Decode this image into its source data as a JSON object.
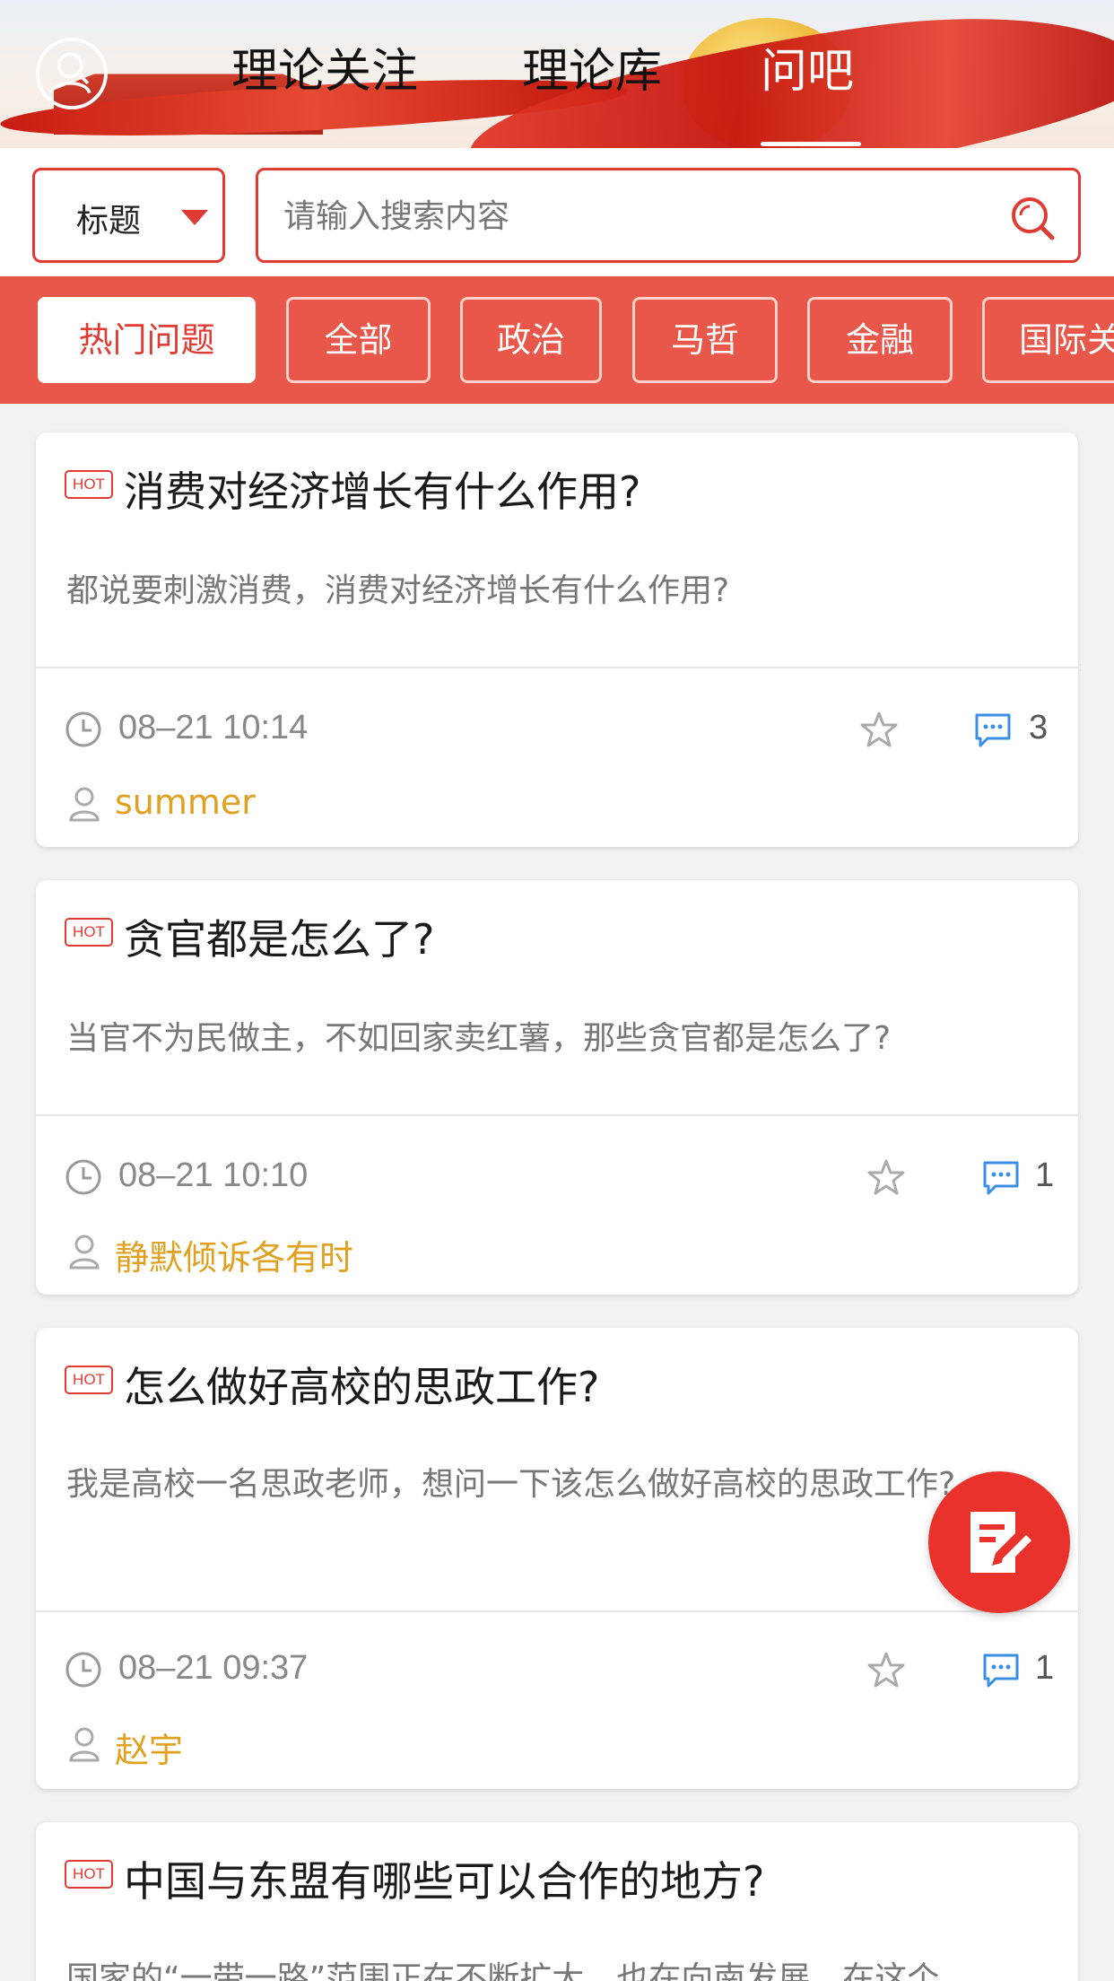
{
  "header": {
    "tabs": [
      {
        "label": "理论关注",
        "active": false
      },
      {
        "label": "理论库",
        "active": false
      },
      {
        "label": "问吧",
        "active": true
      }
    ]
  },
  "search": {
    "field_selected": "标题",
    "placeholder": "请输入搜索内容",
    "value": ""
  },
  "categories": [
    "热门问题",
    "全部",
    "政治",
    "马哲",
    "金融",
    "国际关"
  ],
  "active_category": "热门问题",
  "questions": [
    {
      "badge": "HOT",
      "title": "消费对经济增长有什么作用?",
      "desc": "都说要刺激消费，消费对经济增长有什么作用?",
      "time": "08–21 10:14",
      "comments": "3",
      "author": "summer"
    },
    {
      "badge": "HOT",
      "title": "贪官都是怎么了?",
      "desc": "当官不为民做主，不如回家卖红薯，那些贪官都是怎么了?",
      "time": "08–21 10:10",
      "comments": "1",
      "author": "静默倾诉各有时"
    },
    {
      "badge": "HOT",
      "title": "怎么做好高校的思政工作?",
      "desc": "我是高校一名思政老师，想问一下该怎么做好高校的思政工作?",
      "time": "08–21 09:37",
      "comments": "1",
      "author": "赵宇"
    },
    {
      "badge": "HOT",
      "title": "中国与东盟有哪些可以合作的地方?",
      "desc": "国家的“一带一路”范围正在不断扩大，也在向南发展，在这个"
    }
  ],
  "colors": {
    "accent": "#e03b33",
    "category_strip": "#e8574a",
    "author": "#e0a020",
    "comment_icon": "#3a8ee6"
  },
  "icons": {
    "user": "user-search-icon",
    "search": "search-icon",
    "dropdown": "chevron-down-icon",
    "time": "clock-icon",
    "favorite": "star-icon",
    "comment": "comment-icon",
    "author": "person-icon",
    "compose": "compose-icon"
  }
}
